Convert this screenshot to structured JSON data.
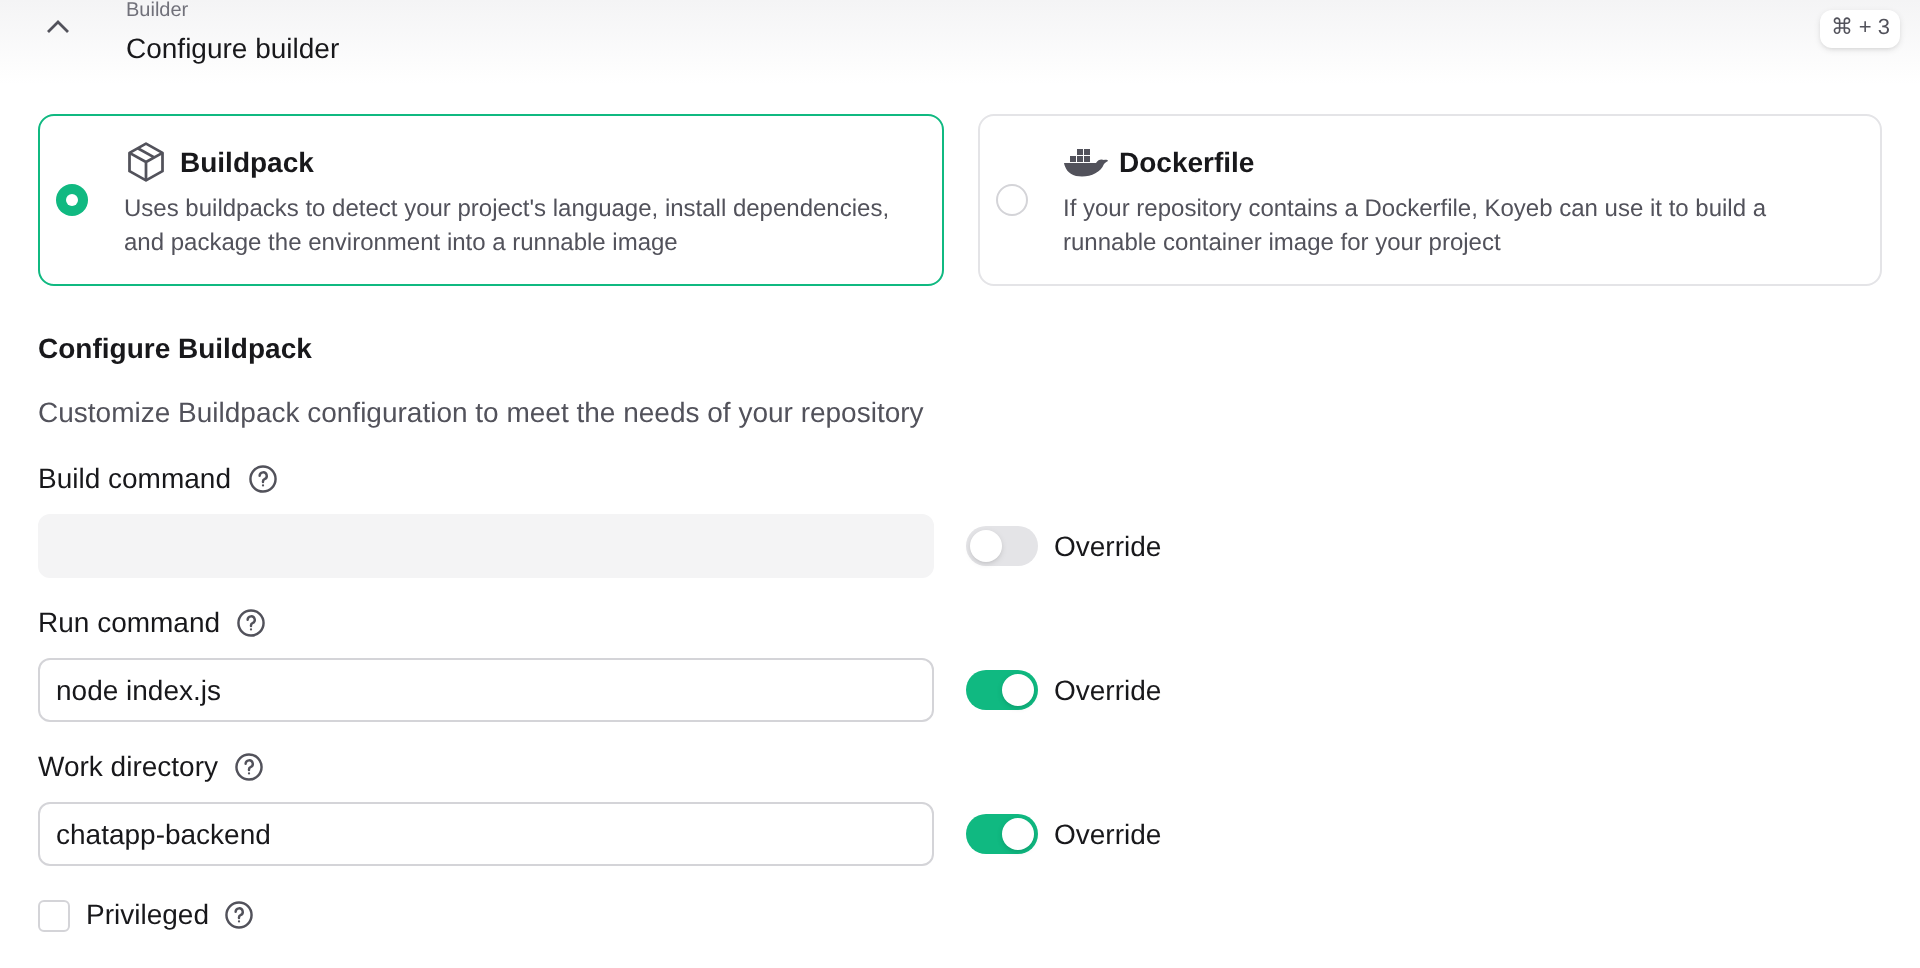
{
  "header": {
    "section": "Builder",
    "title": "Configure builder",
    "expanded": true,
    "shortcut": "⌘ + 3"
  },
  "builder_options": [
    {
      "kind": "buildpack",
      "label": "Buildpack",
      "description": "Uses buildpacks to detect your project's language, install dependencies, and package the environment into a runnable image",
      "selected": true
    },
    {
      "kind": "docker",
      "label": "Dockerfile",
      "description": "If your repository contains a Dockerfile, Koyeb can use it to build a runnable container image for your project",
      "selected": false
    }
  ],
  "configure": {
    "title": "Configure Buildpack",
    "description": "Customize Buildpack configuration to meet the needs of your repository"
  },
  "fields": [
    {
      "label": "Build command",
      "override_label": "Override",
      "override": false
    },
    {
      "label": "Run command",
      "value": "node index.js",
      "override_label": "Override",
      "override": true
    },
    {
      "label": "Work directory",
      "value": "chatapp-backend",
      "override_label": "Override",
      "override": true
    }
  ],
  "privileged": {
    "label": "Privileged",
    "checked": false
  }
}
